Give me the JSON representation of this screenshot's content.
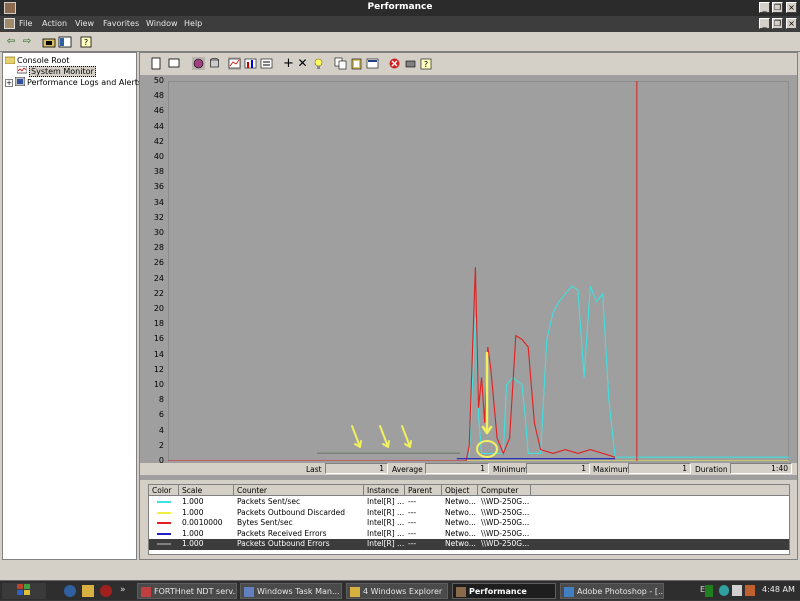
{
  "window": {
    "title": "Performance",
    "menu": [
      "File",
      "Action",
      "View",
      "Favorites",
      "Window",
      "Help"
    ]
  },
  "tree": {
    "root": "Console Root",
    "items": [
      "System Monitor",
      "Performance Logs and Alerts"
    ]
  },
  "chart_data": {
    "type": "line",
    "ylim": [
      0,
      50
    ],
    "yticks": [
      "50",
      "48",
      "46",
      "44",
      "42",
      "40",
      "38",
      "36",
      "34",
      "32",
      "30",
      "28",
      "26",
      "24",
      "22",
      "20",
      "18",
      "16",
      "14",
      "12",
      "10",
      "8",
      "6",
      "4",
      "2",
      "0"
    ],
    "series": [
      {
        "name": "Packets Sent/sec",
        "color": "#40e0e0",
        "points": [
          [
            0,
            0
          ],
          [
            48,
            0
          ],
          [
            48.5,
            0.5
          ],
          [
            49.5,
            19
          ],
          [
            50,
            6
          ],
          [
            50.5,
            1
          ],
          [
            54,
            1
          ],
          [
            54.5,
            10
          ],
          [
            55.5,
            11
          ],
          [
            57,
            10
          ],
          [
            57.5,
            6
          ],
          [
            58,
            1
          ],
          [
            60,
            1
          ],
          [
            61,
            16
          ],
          [
            62,
            19.5
          ],
          [
            63,
            21
          ],
          [
            64,
            22
          ],
          [
            65,
            23
          ],
          [
            66,
            22.5
          ],
          [
            67,
            11
          ],
          [
            68,
            23
          ],
          [
            69,
            21
          ],
          [
            70,
            22
          ],
          [
            71,
            8
          ],
          [
            72,
            0.5
          ],
          [
            100,
            0.5
          ]
        ]
      },
      {
        "name": "Packets Outbound Discarded",
        "color": "#f0f040",
        "points": [
          [
            0,
            0
          ],
          [
            100,
            0
          ]
        ]
      },
      {
        "name": "Bytes Sent/sec",
        "color": "#e02020",
        "points": [
          [
            0,
            0
          ],
          [
            48,
            0
          ],
          [
            48.5,
            2
          ],
          [
            49.5,
            25.5
          ],
          [
            50,
            7
          ],
          [
            50.5,
            11
          ],
          [
            51,
            5
          ],
          [
            51.5,
            15
          ],
          [
            52,
            12
          ],
          [
            53,
            3
          ],
          [
            54,
            1
          ],
          [
            55,
            3
          ],
          [
            56,
            16.5
          ],
          [
            57,
            16
          ],
          [
            58,
            15
          ],
          [
            59,
            5
          ],
          [
            60,
            1.5
          ],
          [
            62,
            1
          ],
          [
            64,
            1.5
          ],
          [
            66,
            1
          ],
          [
            68,
            1.5
          ],
          [
            70,
            1
          ],
          [
            72,
            0.5
          ]
        ]
      },
      {
        "name": "Packets Received Errors",
        "color": "#2020c0",
        "points": [
          [
            46.5,
            0.3
          ],
          [
            72,
            0.3
          ]
        ]
      },
      {
        "name": "Packets Outbound Errors",
        "color": "#808080",
        "points": [
          [
            24,
            1
          ],
          [
            47,
            1
          ]
        ]
      }
    ],
    "green_baseline": {
      "color": "#308030",
      "points": [
        [
          24,
          1
        ],
        [
          47,
          1
        ]
      ]
    },
    "cursor_x": 75.5,
    "stats": {
      "last_label": "Last",
      "last_value": "1",
      "average_label": "Average",
      "average_value": "1",
      "minimum_label": "Minimum",
      "minimum_value": "1",
      "maximum_label": "Maximum",
      "maximum_value": "1",
      "duration_label": "Duration",
      "duration_value": "1:40"
    }
  },
  "table": {
    "headers": [
      "Color",
      "Scale",
      "Counter",
      "Instance",
      "Parent",
      "Object",
      "Computer"
    ],
    "rows": [
      {
        "color": "#40e0e0",
        "scale": "1.000",
        "counter": "Packets Sent/sec",
        "instance": "Intel[R] ...",
        "parent": "---",
        "object": "Netwo...",
        "computer": "\\\\WD-250G...",
        "selected": false
      },
      {
        "color": "#f0f040",
        "scale": "1.000",
        "counter": "Packets Outbound Discarded",
        "instance": "Intel[R] ...",
        "parent": "---",
        "object": "Netwo...",
        "computer": "\\\\WD-250G...",
        "selected": false
      },
      {
        "color": "#e02020",
        "scale": "0.0010000",
        "counter": "Bytes Sent/sec",
        "instance": "Intel[R] ...",
        "parent": "---",
        "object": "Netwo...",
        "computer": "\\\\WD-250G...",
        "selected": false
      },
      {
        "color": "#2020c0",
        "scale": "1.000",
        "counter": "Packets Received Errors",
        "instance": "Intel[R] ...",
        "parent": "---",
        "object": "Netwo...",
        "computer": "\\\\WD-250G...",
        "selected": false
      },
      {
        "color": "#808080",
        "scale": "1.000",
        "counter": "Packets Outbound Errors",
        "instance": "Intel[R] ...",
        "parent": "---",
        "object": "Netwo...",
        "computer": "\\\\WD-250G...",
        "selected": true
      }
    ]
  },
  "taskbar": {
    "tasks": [
      {
        "label": "FORTHnet NDT serv...",
        "active": false
      },
      {
        "label": "Windows Task Man...",
        "active": false
      },
      {
        "label": "4 Windows Explorer",
        "active": false
      },
      {
        "label": "Performance",
        "active": true
      },
      {
        "label": "Adobe Photoshop - [...",
        "active": false
      }
    ],
    "language": "EN",
    "clock": "4:48 AM"
  }
}
